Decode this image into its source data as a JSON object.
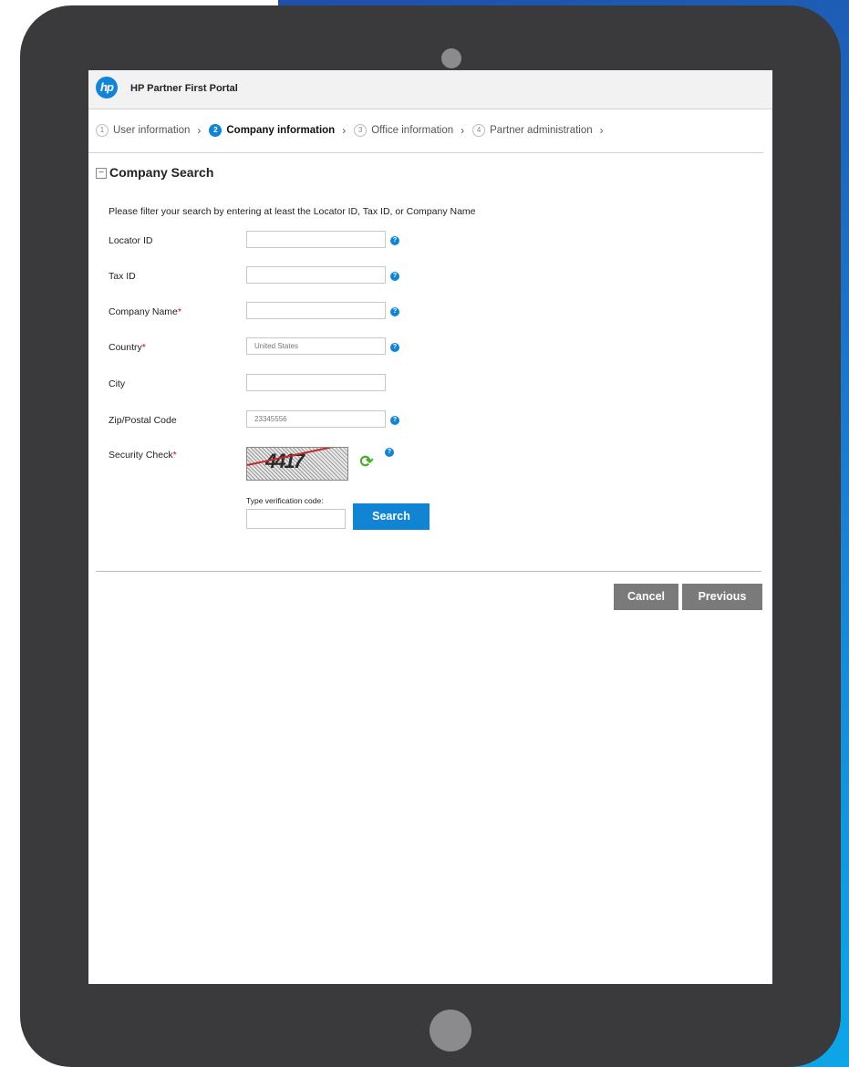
{
  "header": {
    "logo_text": "hp",
    "portal_title": "HP Partner First Portal"
  },
  "steps": [
    {
      "num": "1",
      "label": "User information"
    },
    {
      "num": "2",
      "label": "Company information",
      "active": true
    },
    {
      "num": "3",
      "label": "Office information"
    },
    {
      "num": "4",
      "label": "Partner administration"
    }
  ],
  "section": {
    "toggle": "−",
    "title": "Company Search",
    "instructions": "Please filter your search by entering at least the Locator ID, Tax ID, or Company Name"
  },
  "form": {
    "locator_id": {
      "label": "Locator ID",
      "value": ""
    },
    "tax_id": {
      "label": "Tax ID",
      "value": ""
    },
    "company_name": {
      "label": "Company Name",
      "required": "*",
      "value": ""
    },
    "country": {
      "label": "Country",
      "required": "*",
      "value": "United States"
    },
    "city": {
      "label": "City",
      "value": ""
    },
    "zip": {
      "label": "Zip/Postal Code",
      "value": "23345556"
    },
    "security": {
      "label": "Security Check",
      "required": "*",
      "captcha_text": "4417"
    },
    "verify_label": "Type verification code:",
    "search_button": "Search"
  },
  "footer": {
    "cancel_button": "Cancel",
    "previous_button": "Previous"
  },
  "colors": {
    "accent": "#1185d4",
    "button_gray": "#7a7a7a",
    "required": "#d0021b",
    "refresh": "#4cae2e"
  },
  "icons": {
    "help": "help-icon",
    "refresh": "refresh-icon",
    "logo": "hp-logo"
  }
}
